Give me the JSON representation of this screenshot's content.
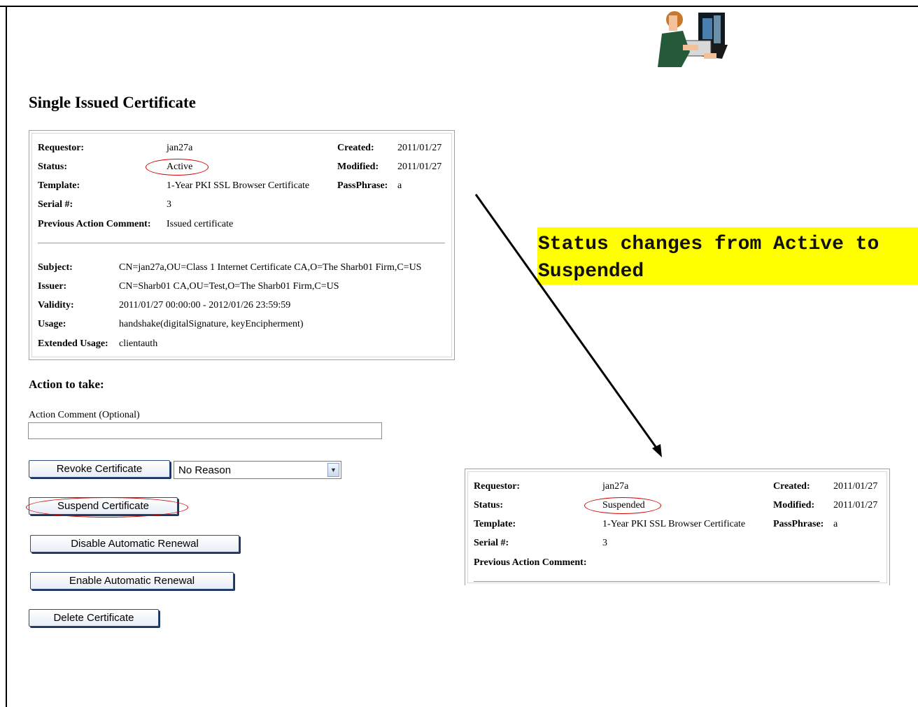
{
  "page_title": "Single Issued Certificate",
  "certificate": {
    "labels": {
      "requestor": "Requestor:",
      "status": "Status:",
      "template": "Template:",
      "serial": "Serial #:",
      "previous_comment": "Previous Action Comment:",
      "created": "Created:",
      "modified": "Modified:",
      "passphrase": "PassPhrase:",
      "subject": "Subject:",
      "issuer": "Issuer:",
      "validity": "Validity:",
      "usage": "Usage:",
      "extended_usage": "Extended Usage:"
    },
    "requestor": "jan27a",
    "status": "Active",
    "template": "1-Year PKI SSL Browser Certificate",
    "serial": "3",
    "previous_comment": "Issued certificate",
    "created": "2011/01/27",
    "modified": "2011/01/27",
    "passphrase": "a",
    "subject": "CN=jan27a,OU=Class 1 Internet Certificate CA,O=The Sharb01 Firm,C=US",
    "issuer": "CN=Sharb01 CA,OU=Test,O=The Sharb01 Firm,C=US",
    "validity": "2011/01/27 00:00:00 - 2012/01/26 23:59:59",
    "usage": "handshake(digitalSignature, keyEncipherment)",
    "extended_usage": "clientauth"
  },
  "action": {
    "title": "Action to take:",
    "comment_label": "Action Comment (Optional)",
    "comment_value": "",
    "revoke_label": "Revoke Certificate",
    "reason_selected": "No Reason",
    "suspend_label": "Suspend Certificate",
    "disable_renewal_label": "Disable Automatic Renewal",
    "enable_renewal_label": "Enable Automatic Renewal",
    "delete_label": "Delete Certificate"
  },
  "annotation": {
    "note": "Status changes from Active to Suspended",
    "note_color": "#ffff00",
    "highlight_color": "#d40000"
  },
  "updated_certificate": {
    "requestor": "jan27a",
    "status": "Suspended",
    "template": "1-Year PKI SSL Browser Certificate",
    "serial": "3",
    "previous_comment": "",
    "created": "2011/01/27",
    "modified": "2011/01/27",
    "passphrase": "a"
  },
  "icons": {
    "clipart": "person-at-computer-clipart",
    "dropdown": "chevron-down-icon",
    "arrow": "diagonal-arrow"
  }
}
